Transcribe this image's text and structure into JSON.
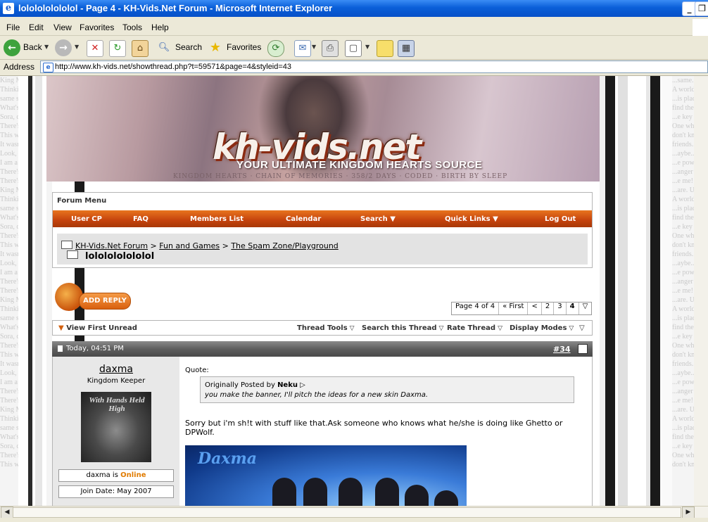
{
  "window": {
    "title": "lololololololol - Page 4 - KH-Vids.Net Forum - Microsoft Internet Explorer",
    "minimize_glyph": "_",
    "restore_glyph": "❐"
  },
  "menu": [
    "File",
    "Edit",
    "View",
    "Favorites",
    "Tools",
    "Help"
  ],
  "toolbar": {
    "back_label": "Back",
    "search_label": "Search",
    "favorites_label": "Favorites"
  },
  "address": {
    "label": "Address",
    "url": "http://www.kh-vids.net/showthread.php?t=59571&page=4&styleid=43"
  },
  "banner": {
    "logo": "kh-vids.net",
    "tagline": "YOUR ULTIMATE KINGDOM HEARTS SOURCE",
    "strip": "KINGDOM HEARTS · CHAIN OF MEMORIES · 358/2 DAYS · CODED · BIRTH BY SLEEP"
  },
  "forum_menu": {
    "title": "Forum Menu",
    "items": [
      "User CP",
      "FAQ",
      "Members List",
      "Calendar",
      "Search",
      "Quick Links",
      "Log Out"
    ]
  },
  "breadcrumb": {
    "links": [
      "KH-Vids.Net Forum",
      "Fun and Games",
      "The Spam Zone/Playground"
    ],
    "separator": ">",
    "thread_title": "lololololololol"
  },
  "add_reply": "ADD REPLY",
  "pagination": {
    "summary": "Page 4 of 4",
    "first": "« First",
    "prev": "<",
    "pages": [
      "2",
      "3",
      "4"
    ],
    "current": "4"
  },
  "thread_bar": {
    "view_first_unread": "View First Unread",
    "tools": [
      "Thread Tools",
      "Search this Thread",
      "Rate Thread",
      "Display Modes"
    ]
  },
  "post": {
    "date": "Today, 04:51 PM",
    "number": "#34",
    "username": "daxma",
    "user_title": "Kingdom Keeper",
    "avatar_text": "With Hands Held High",
    "status_prefix": "daxma is",
    "status": "Online",
    "join_date": "Join Date: May 2007",
    "quote_label": "Quote:",
    "quote_by_prefix": "Originally Posted by",
    "quote_author": "Neku",
    "quote_text": "you make the banner, I'll pitch the ideas for a new skin Daxma.",
    "text": "Sorry but i'm sh!t with stuff like that.Ask someone who knows what he/she is doing like Ghetto or DPWolf.",
    "signature_name": "Daxma"
  },
  "background_text": {
    "left": [
      "King Mickey...",
      "Thinking of y...",
      "same sky-one...",
      "What's the m...",
      "Sora, don't e...",
      "There's some...",
      "This world ha...",
      "It wasn't a dr...",
      "Look, I got sc...",
      "I am a servan...",
      "There's no ki...",
      "There's some...",
      "King Mickey...",
      "Thinking of y...",
      "same sky-one...",
      "What's the m...",
      "Sora, don't e...",
      "There's some...",
      "This world ha...",
      "It wasn't a dr...",
      "Look, I got sc...",
      "I am a servan...",
      "There's no ki...",
      "There's some...",
      "King Mickey...",
      "Thinking of y...",
      "same sky-one...",
      "What's the m...",
      "Sora, don't e...",
      "There's some...",
      "This world ha...",
      "It wasn't a dr...",
      "Look, I got sc...",
      "I am a servan...",
      "There's no ki...",
      "There's some...",
      "King Mickey...",
      "Thinking of y...",
      "same sky-one...",
      "What's the m...",
      "Sora, don't e...",
      "There's some...",
      "This world ha..."
    ],
    "right": [
      "...same.",
      "A world...",
      "...is place...",
      "find the k...",
      "...e key to...",
      "One wh...",
      "don't kno...",
      "friends. H...",
      "...aybe...",
      "...e power...",
      "...anger of...",
      "...e me! I...",
      "...are. Ulti...",
      "A world...",
      "...is place...",
      "find the k...",
      "...e key to...",
      "One wh...",
      "don't kno...",
      "friends. H...",
      "...aybe...",
      "...e power...",
      "...anger of...",
      "...e me! I...",
      "...are. Ulti...",
      "A world...",
      "...is place...",
      "find the k...",
      "...e key to...",
      "One wh...",
      "don't kno...",
      "friends. H...",
      "...aybe...",
      "...e power...",
      "...anger of...",
      "...e me! I...",
      "...are. Ulti...",
      "A world...",
      "...is place...",
      "find the k...",
      "...e key to...",
      "One wh...",
      "don't kno..."
    ]
  },
  "colors": {
    "titlebar": "#0a5fd8",
    "menu_bar_orange": "#c4420d",
    "online": "#e07b00"
  }
}
